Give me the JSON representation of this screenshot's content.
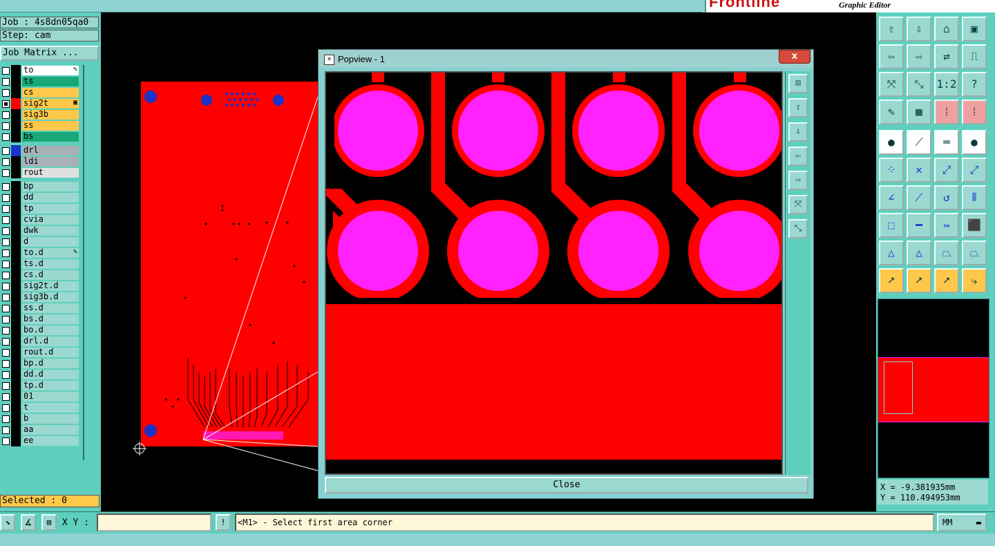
{
  "brand": {
    "logo": "Frontline",
    "title": "Graphic Editor"
  },
  "left": {
    "job": "Job : 4s8dn05qa0",
    "step": "Step: cam",
    "job_matrix": "Job Matrix ...",
    "selected": "Selected : 0",
    "layers": [
      {
        "name": "to",
        "checked": false,
        "color": "#ffffff",
        "swatch": "#000000",
        "mark": "✎"
      },
      {
        "name": "ts",
        "checked": false,
        "color": "#18a878",
        "swatch": "#000000",
        "mark": ""
      },
      {
        "name": "cs",
        "checked": false,
        "color": "#ffc84a",
        "swatch": "#000000",
        "mark": ""
      },
      {
        "name": "sig2t",
        "checked": true,
        "color": "#ffc84a",
        "swatch": "#ff0000",
        "mark": "▣"
      },
      {
        "name": "sig3b",
        "checked": false,
        "color": "#ffc84a",
        "swatch": "#000000",
        "mark": ""
      },
      {
        "name": "ss",
        "checked": false,
        "color": "#ffc84a",
        "swatch": "#000000",
        "mark": ""
      },
      {
        "name": "bs",
        "checked": false,
        "color": "#18a878",
        "swatch": "#000000",
        "mark": ""
      },
      {
        "name": "drl",
        "checked": false,
        "color": "#a8b0b8",
        "swatch": "#1a33c9",
        "mark": ""
      },
      {
        "name": "ldi",
        "checked": false,
        "color": "#a8b0b8",
        "swatch": "#000000",
        "mark": ""
      },
      {
        "name": "rout",
        "checked": false,
        "color": "#e0e0e0",
        "swatch": "#000000",
        "mark": ""
      },
      {
        "name": "bp",
        "checked": false,
        "color": "#9ad8d0",
        "swatch": "#000000",
        "mark": ""
      },
      {
        "name": "dd",
        "checked": false,
        "color": "#9ad8d0",
        "swatch": "#000000",
        "mark": ""
      },
      {
        "name": "tp",
        "checked": false,
        "color": "#9ad8d0",
        "swatch": "#000000",
        "mark": ""
      },
      {
        "name": "cvia",
        "checked": false,
        "color": "#9ad8d0",
        "swatch": "#000000",
        "mark": ""
      },
      {
        "name": "dwk",
        "checked": false,
        "color": "#9ad8d0",
        "swatch": "#000000",
        "mark": ""
      },
      {
        "name": "d",
        "checked": false,
        "color": "#9ad8d0",
        "swatch": "#000000",
        "mark": ""
      },
      {
        "name": "to.d",
        "checked": false,
        "color": "#9ad8d0",
        "swatch": "#000000",
        "mark": "✎"
      },
      {
        "name": "ts.d",
        "checked": false,
        "color": "#9ad8d0",
        "swatch": "#000000",
        "mark": ""
      },
      {
        "name": "cs.d",
        "checked": false,
        "color": "#9ad8d0",
        "swatch": "#000000",
        "mark": ""
      },
      {
        "name": "sig2t.d",
        "checked": false,
        "color": "#9ad8d0",
        "swatch": "#000000",
        "mark": ""
      },
      {
        "name": "sig3b.d",
        "checked": false,
        "color": "#9ad8d0",
        "swatch": "#000000",
        "mark": ""
      },
      {
        "name": "ss.d",
        "checked": false,
        "color": "#9ad8d0",
        "swatch": "#000000",
        "mark": ""
      },
      {
        "name": "bs.d",
        "checked": false,
        "color": "#9ad8d0",
        "swatch": "#000000",
        "mark": ""
      },
      {
        "name": "bo.d",
        "checked": false,
        "color": "#9ad8d0",
        "swatch": "#000000",
        "mark": ""
      },
      {
        "name": "drl.d",
        "checked": false,
        "color": "#9ad8d0",
        "swatch": "#000000",
        "mark": ""
      },
      {
        "name": "rout.d",
        "checked": false,
        "color": "#9ad8d0",
        "swatch": "#000000",
        "mark": ""
      },
      {
        "name": "bp.d",
        "checked": false,
        "color": "#9ad8d0",
        "swatch": "#000000",
        "mark": ""
      },
      {
        "name": "dd.d",
        "checked": false,
        "color": "#9ad8d0",
        "swatch": "#000000",
        "mark": ""
      },
      {
        "name": "tp.d",
        "checked": false,
        "color": "#9ad8d0",
        "swatch": "#000000",
        "mark": ""
      },
      {
        "name": "01",
        "checked": false,
        "color": "#9ad8d0",
        "swatch": "#000000",
        "mark": ""
      },
      {
        "name": "t",
        "checked": false,
        "color": "#9ad8d0",
        "swatch": "#000000",
        "mark": ""
      },
      {
        "name": "b",
        "checked": false,
        "color": "#9ad8d0",
        "swatch": "#000000",
        "mark": ""
      },
      {
        "name": "aa",
        "checked": false,
        "color": "#9ad8d0",
        "swatch": "#000000",
        "mark": ""
      },
      {
        "name": "ee",
        "checked": false,
        "color": "#9ad8d0",
        "swatch": "#000000",
        "mark": ""
      }
    ]
  },
  "popview": {
    "title": "Popview - 1",
    "close_x": "x",
    "close_button": "Close",
    "side_icons": [
      "zoom-home-icon",
      "pan-up-icon",
      "pan-down-icon",
      "pan-left-icon",
      "pan-right-icon",
      "zoom-in-icon",
      "zoom-out-icon"
    ]
  },
  "toolbar": {
    "rows": [
      [
        "pan-up-icon",
        "pan-down-icon",
        "home-icon",
        "panel-icon"
      ],
      [
        "pan-left-icon",
        "pan-right-icon",
        "swap-icon",
        "snap-icon"
      ],
      [
        "zoom-in-icon",
        "zoom-out-icon",
        "scale-1-2-icon",
        "help-icon"
      ],
      [
        "measure-icon",
        "grid-icon",
        "layers-red-icon",
        "layers-red2-icon"
      ],
      [
        "fill-pad-icon",
        "line-tool-icon",
        "ruler-icon",
        "pad-icon"
      ],
      [
        "node-icon",
        "cross-icon",
        "point-red-icon",
        "point-blue-icon"
      ],
      [
        "angle-icon",
        "line-red-icon",
        "rotate-icon",
        "mirror-icon"
      ],
      [
        "select-box-icon",
        "line-bar-icon",
        "fit-icon",
        "color-blocks-icon"
      ],
      [
        "triangle-icon",
        "triangle2-icon",
        "triangle3-icon",
        "triangle4-icon"
      ],
      [
        "pointer-icon",
        "pointer2-icon",
        "pointer3-icon",
        "route-icon"
      ]
    ],
    "labels": {
      "scale": "1:2",
      "help": "?"
    }
  },
  "coords": {
    "x": "X = -9.381935mm",
    "y": "Y = 110.494953mm"
  },
  "bottom": {
    "xy_label": "X Y :",
    "message": "<M1> - Select first area corner",
    "alert": "!",
    "unit": "MM"
  },
  "colors": {
    "copper": "#ff0000",
    "pad": "#ff22ff",
    "via": "#1a33c9"
  }
}
